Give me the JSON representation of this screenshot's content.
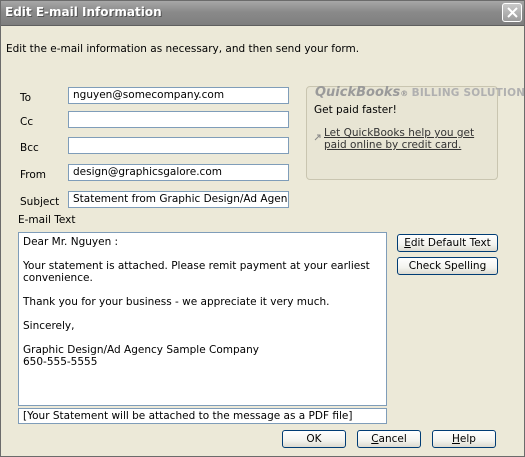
{
  "window": {
    "title": "Edit E-mail Information",
    "instructions": "Edit the e-mail information as necessary, and then send your form."
  },
  "fields": {
    "to": {
      "label": "To",
      "value": "nguyen@somecompany.com"
    },
    "cc": {
      "label": "Cc",
      "value": ""
    },
    "bcc": {
      "label": "Bcc",
      "value": ""
    },
    "from": {
      "label": "From",
      "value": "design@graphicsgalore.com"
    },
    "subject": {
      "label": "Subject",
      "value": "Statement from Graphic Design/Ad Agency Sa..."
    }
  },
  "quickbooks": {
    "logo_main": "QuickBooks",
    "logo_reg": "®",
    "logo_sub": "BILLING SOLUTIONS",
    "tagline": "Get paid faster!",
    "link": "Let QuickBooks help you get paid online by credit card."
  },
  "email_text": {
    "label": "E-mail Text",
    "lines": [
      "Dear Mr. Nguyen :",
      "",
      "Your statement is attached.  Please remit payment at your earliest",
      "convenience.",
      "",
      "Thank you for your business - we appreciate it very much.",
      "",
      "Sincerely,",
      "",
      "Graphic Design/Ad Agency Sample Company",
      "650-555-5555"
    ]
  },
  "attachment_note": "[Your Statement will be attached to the message as a PDF file]",
  "buttons": {
    "edit_default_text_prefix": "E",
    "edit_default_text_rest": "dit Default Text",
    "check_spelling": "Check Spelling",
    "ok": "OK",
    "cancel_prefix": "C",
    "cancel_rest": "ancel",
    "help_prefix": "H",
    "help_rest": "elp"
  },
  "colors": {
    "dialog_background": "#ece9d8",
    "title_bar": "#8a8a8a",
    "field_border": "#7f9db9",
    "button_border": "#003c74"
  }
}
